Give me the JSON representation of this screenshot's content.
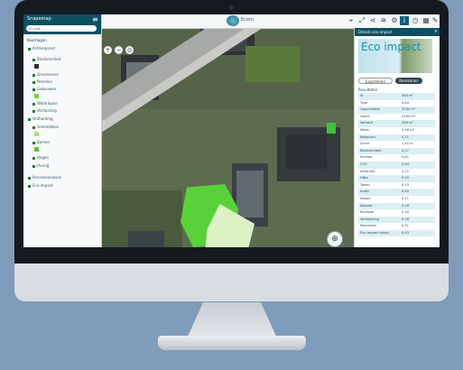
{
  "app": {
    "logo_text": "Ecom"
  },
  "sidebar": {
    "title": "Snapemap",
    "search_placeholder": "Q zoek",
    "header_label": "Kaartlagen",
    "items": [
      {
        "label": "Achtergrond"
      },
      {
        "label": "Biodiversiteit"
      },
      {
        "label": "Groenzones"
      },
      {
        "label": "Percelen"
      },
      {
        "label": "Gebouwen"
      },
      {
        "label": "Waterlopen"
      },
      {
        "label": "Verharding"
      },
      {
        "label": "Ontharding"
      },
      {
        "label": "Groendaken"
      },
      {
        "label": "Bomen"
      },
      {
        "label": "Hagen"
      },
      {
        "label": "Overig"
      },
      {
        "label": "Perceelsanalyse"
      },
      {
        "label": "Eco-impact"
      }
    ]
  },
  "panel": {
    "title": "Details eco-impact",
    "banner_text": "Eco impact",
    "button_secondary": "Exporteren",
    "button_primary": "Berekenen",
    "subtitle": "Resultaten",
    "rows": [
      {
        "k": "Id",
        "v": "484 m²"
      },
      {
        "k": "Type",
        "v": "0,84"
      },
      {
        "k": "Oppervlakte",
        "v": "2044 m²"
      },
      {
        "k": "Groen",
        "v": "4264 m²"
      },
      {
        "k": "Verhard",
        "v": "396 m²"
      },
      {
        "k": "Water",
        "v": "0,56 m²"
      },
      {
        "k": "Bebouwd",
        "v": "0,21"
      },
      {
        "k": "Score",
        "v": "1,40 m"
      },
      {
        "k": "Biodiversiteit",
        "v": "0,07"
      },
      {
        "k": "Klimaat",
        "v": "0,61"
      },
      {
        "k": "CO2",
        "v": "0,54"
      },
      {
        "k": "Infiltratie",
        "v": "0,22"
      },
      {
        "k": "Hitte",
        "v": "0,19"
      },
      {
        "k": "Totaal",
        "v": "0,33"
      },
      {
        "k": "Index",
        "v": "0,40"
      },
      {
        "k": "Klasse",
        "v": "0,21"
      },
      {
        "k": "Waarde",
        "v": "0,18"
      },
      {
        "k": "Bijdrage",
        "v": "0,30"
      },
      {
        "k": "Verbetering",
        "v": "0,26"
      },
      {
        "k": "Potentieel",
        "v": "0,51"
      },
      {
        "k": "Eco-impact totaal",
        "v": "0,43"
      }
    ]
  }
}
